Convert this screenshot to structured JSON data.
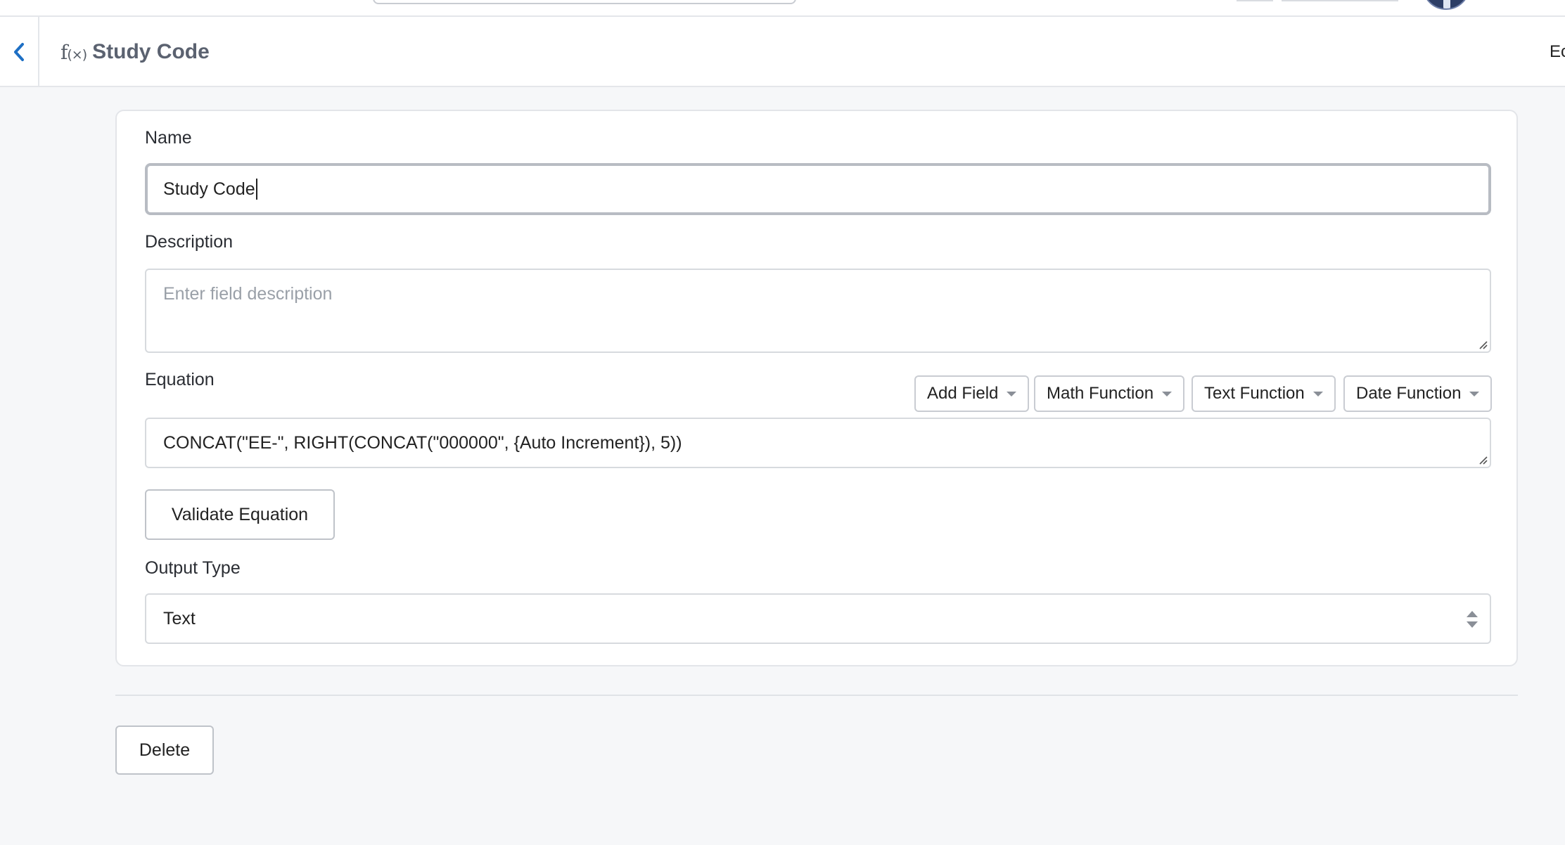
{
  "header": {
    "title": "Study Code",
    "fx_icon_glyph": "f",
    "fx_icon_sub": "(×)",
    "edit_label": "Ec"
  },
  "form": {
    "name": {
      "label": "Name",
      "value": "Study Code"
    },
    "description": {
      "label": "Description",
      "placeholder": "Enter field description",
      "value": ""
    },
    "equation": {
      "label": "Equation",
      "value": "CONCAT(\"EE-\", RIGHT(CONCAT(\"000000\", {Auto Increment}), 5))",
      "dropdowns": [
        {
          "label": "Add Field"
        },
        {
          "label": "Math Function"
        },
        {
          "label": "Text Function"
        },
        {
          "label": "Date Function"
        }
      ],
      "validate_label": "Validate Equation"
    },
    "output_type": {
      "label": "Output Type",
      "selected": "Text"
    }
  },
  "footer": {
    "delete_label": "Delete"
  },
  "icons": {
    "back": "chevron-left-icon",
    "fx": "function-icon",
    "dropdown": "caret-down-icon",
    "select": "select-arrows-icon",
    "resize": "resize-grip-icon"
  },
  "colors": {
    "background": "#f6f7f9",
    "card": "#ffffff",
    "accent": "#1d6fc4",
    "title": "#5b6270",
    "placeholder": "#9aa0a8"
  }
}
